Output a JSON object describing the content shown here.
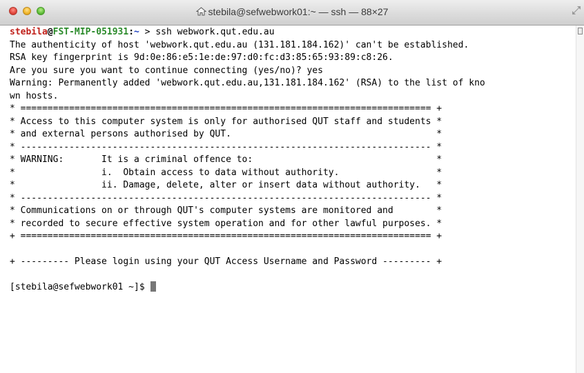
{
  "window": {
    "title": "stebila@sefwebwork01:~ — ssh — 88×27"
  },
  "terminal": {
    "first_prompt": {
      "user": "stebila",
      "at": "@",
      "host": "FST-MIP-051931",
      "colon": ":",
      "path": "~",
      "command": " > ssh webwork.qut.edu.au"
    },
    "lines": [
      "The authenticity of host 'webwork.qut.edu.au (131.181.184.162)' can't be established.",
      "RSA key fingerprint is 9d:0e:86:e5:1e:de:97:d0:fc:d3:85:65:93:89:c8:26.",
      "Are you sure you want to continue connecting (yes/no)? yes",
      "Warning: Permanently added 'webwork.qut.edu.au,131.181.184.162' (RSA) to the list of kno",
      "wn hosts.",
      "* ============================================================================ +",
      "* Access to this computer system is only for authorised QUT staff and students *",
      "* and external persons authorised by QUT.                                      *",
      "* ---------------------------------------------------------------------------- *",
      "* WARNING:       It is a criminal offence to:                                  *",
      "*                i.  Obtain access to data without authority.                  *",
      "*                ii. Damage, delete, alter or insert data without authority.   *",
      "* ---------------------------------------------------------------------------- *",
      "* Communications on or through QUT's computer systems are monitored and        *",
      "* recorded to secure effective system operation and for other lawful purposes. *",
      "+ ============================================================================ +",
      "",
      "+ --------- Please login using your QUT Access Username and Password --------- +",
      ""
    ],
    "final_prompt": "[stebila@sefwebwork01 ~]$ "
  }
}
